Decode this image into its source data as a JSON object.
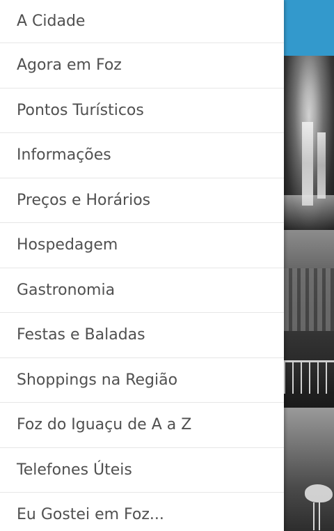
{
  "colors": {
    "header_bg": "#3399cc",
    "drawer_bg": "#ffffff",
    "menu_text": "#505050",
    "divider": "#e6e6e6"
  },
  "drawer": {
    "items": [
      {
        "label": "A Cidade"
      },
      {
        "label": "Agora em Foz"
      },
      {
        "label": "Pontos Turísticos"
      },
      {
        "label": "Informações"
      },
      {
        "label": "Preços e Horários"
      },
      {
        "label": "Hospedagem"
      },
      {
        "label": "Gastronomia"
      },
      {
        "label": "Festas e Baladas"
      },
      {
        "label": "Shoppings na Região"
      },
      {
        "label": "Foz do Iguaçu de A a Z"
      },
      {
        "label": "Telefones Úteis"
      },
      {
        "label": "Eu Gostei em Foz..."
      }
    ]
  }
}
